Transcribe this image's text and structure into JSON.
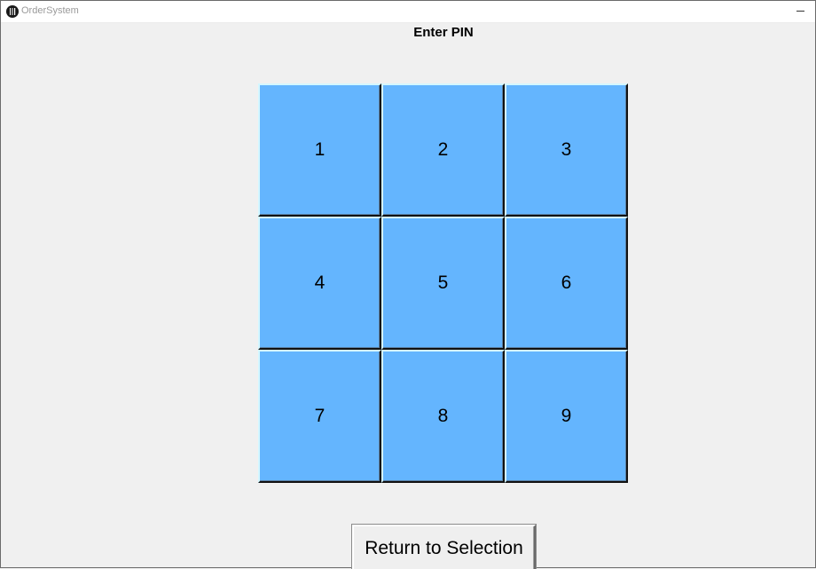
{
  "window": {
    "title": "OrderSystem",
    "app_icon": "utensils-icon",
    "minimize_icon": "minimize-icon"
  },
  "heading": "Enter PIN",
  "keypad": {
    "keys": [
      "1",
      "2",
      "3",
      "4",
      "5",
      "6",
      "7",
      "8",
      "9"
    ],
    "key_color": "#64b5fe"
  },
  "return_button": {
    "label": "Return to Selection"
  }
}
